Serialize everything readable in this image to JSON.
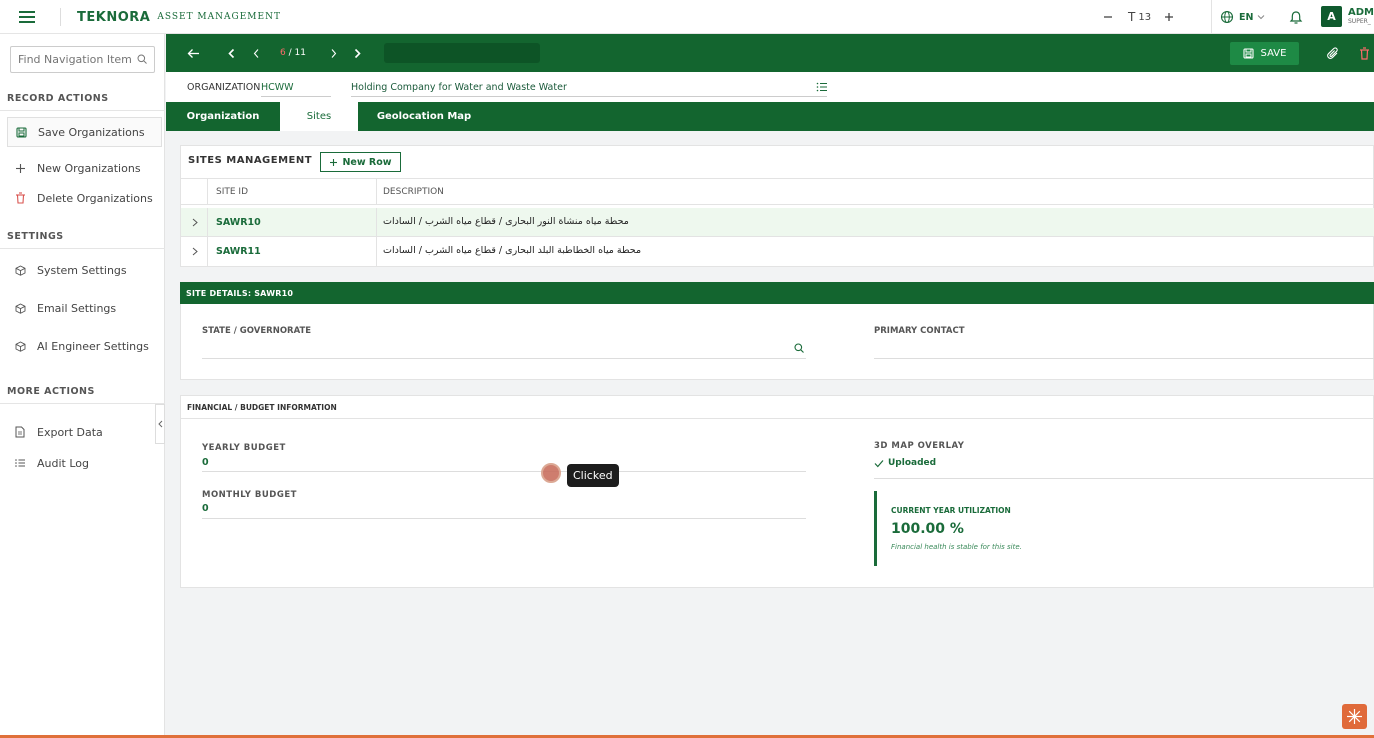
{
  "header": {
    "brand": "TEKNORA",
    "subtitle": "ASSET MANAGEMENT",
    "font_size": "13",
    "language": "EN",
    "avatar_letter": "A",
    "user_name": "ADMI",
    "user_role": "SUPER_"
  },
  "sidebar": {
    "search_placeholder": "Find Navigation Item",
    "record_actions_title": "RECORD ACTIONS",
    "record_actions": [
      {
        "label": "Save Organizations",
        "icon": "save-icon"
      },
      {
        "label": "New Organizations",
        "icon": "plus-icon"
      },
      {
        "label": "Delete Organizations",
        "icon": "trash-icon"
      }
    ],
    "settings_title": "SETTINGS",
    "settings": [
      {
        "label": "System Settings",
        "icon": "cube-icon"
      },
      {
        "label": "Email Settings",
        "icon": "cube-icon"
      },
      {
        "label": "AI Engineer Settings",
        "icon": "cube-icon"
      }
    ],
    "more_actions_title": "MORE ACTIONS",
    "more_actions": [
      {
        "label": "Export Data",
        "icon": "document-icon"
      },
      {
        "label": "Audit Log",
        "icon": "list-icon"
      }
    ]
  },
  "toolbar": {
    "current_page": "6",
    "total_pages": "11",
    "page_sep": " / ",
    "save_label": "SAVE"
  },
  "organization": {
    "label": "ORGANIZATION",
    "code": "HCWW",
    "name": "Holding Company for Water and Waste Water"
  },
  "tabs": [
    {
      "label": "Organization",
      "active": false
    },
    {
      "label": "Sites",
      "active": true
    },
    {
      "label": "Geolocation Map",
      "active": false
    }
  ],
  "sites": {
    "title": "SITES MANAGEMENT",
    "new_row_label": "New Row",
    "columns": [
      "SITE ID",
      "DESCRIPTION"
    ],
    "rows": [
      {
        "site_id": "SAWR10",
        "description": "محطة مياه منشاة النور البحارى / قطاع مياه الشرب / السادات"
      },
      {
        "site_id": "SAWR11",
        "description": "محطة مياه الخطاطبة البلد البحارى / قطاع مياه الشرب / السادات"
      }
    ]
  },
  "site_details": {
    "title": "SITE DETAILS: SAWR10",
    "state_label": "STATE / GOVERNORATE",
    "primary_contact_label": "PRIMARY CONTACT"
  },
  "financial": {
    "title": "FINANCIAL / BUDGET INFORMATION",
    "yearly_label": "YEARLY BUDGET",
    "yearly_value": "0",
    "monthly_label": "MONTHLY BUDGET",
    "monthly_value": "0",
    "map_overlay_label": "3D MAP OVERLAY",
    "map_overlay_status": "Uploaded",
    "utilization_label": "CURRENT YEAR UTILIZATION",
    "utilization_value": "100.00 %",
    "utilization_note": "Financial health is stable for this site."
  },
  "tooltip": {
    "text": "Clicked"
  },
  "colors": {
    "primary": "#13652f",
    "accent": "#1a6b3a",
    "danger": "#d9534f",
    "selected_row": "#eef8ee"
  }
}
